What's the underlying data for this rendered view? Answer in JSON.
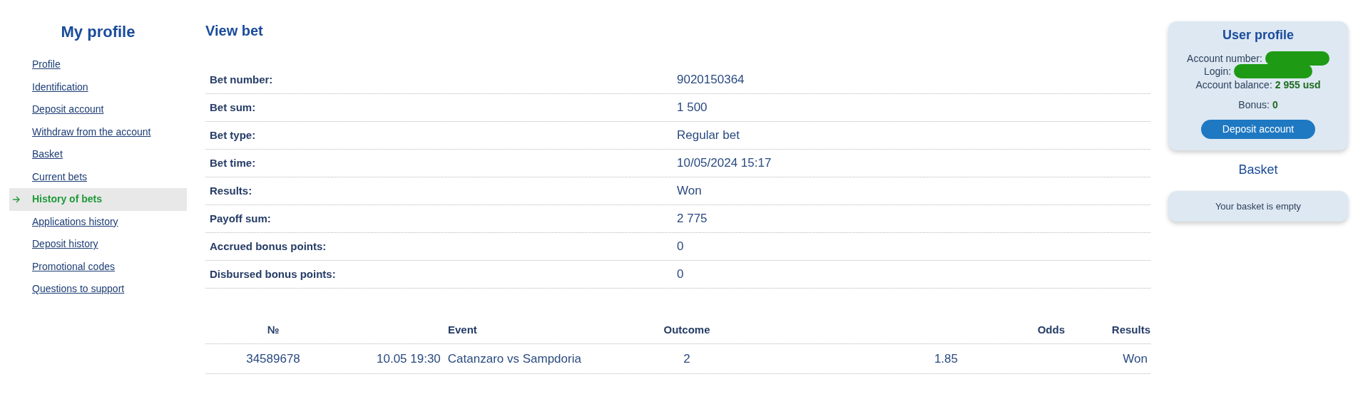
{
  "sidebar": {
    "title": "My profile",
    "items": [
      {
        "label": "Profile",
        "selected": false
      },
      {
        "label": "Identification",
        "selected": false
      },
      {
        "label": "Deposit account",
        "selected": false
      },
      {
        "label": "Withdraw from the account",
        "selected": false
      },
      {
        "label": "Basket",
        "selected": false
      },
      {
        "label": "Current bets",
        "selected": false
      },
      {
        "label": "History of bets",
        "selected": true
      },
      {
        "label": "Applications history",
        "selected": false
      },
      {
        "label": "Deposit history",
        "selected": false
      },
      {
        "label": "Promotional codes",
        "selected": false
      },
      {
        "label": "Questions to support",
        "selected": false
      }
    ]
  },
  "main": {
    "title": "View bet",
    "details": [
      {
        "label": "Bet number:",
        "value": "9020150364"
      },
      {
        "label": "Bet sum:",
        "value": "1 500"
      },
      {
        "label": "Bet type:",
        "value": "Regular bet"
      },
      {
        "label": "Bet time:",
        "value": "10/05/2024 15:17"
      },
      {
        "label": "Results:",
        "value": "Won"
      },
      {
        "label": "Payoff sum:",
        "value": "2 775"
      },
      {
        "label": "Accrued bonus points:",
        "value": "0"
      },
      {
        "label": "Disbursed bonus points:",
        "value": "0"
      }
    ],
    "table": {
      "columns": [
        "№",
        "Event",
        "Outcome",
        "Odds",
        "Results"
      ],
      "rows": [
        {
          "number": "34589678",
          "event_time": "10.05 19:30",
          "event": "Catanzaro vs Sampdoria",
          "outcome": "2",
          "odds": "1.85",
          "result": "Won"
        }
      ]
    }
  },
  "user_profile": {
    "title": "User profile",
    "account_number_label": "Account number:",
    "login_label": "Login:",
    "balance_label": "Account balance:",
    "balance": "2 955 usd",
    "bonus_label": "Bonus:",
    "bonus": "0",
    "button": "Deposit account"
  },
  "basket": {
    "title": "Basket",
    "message": "Your basket is empty"
  }
}
